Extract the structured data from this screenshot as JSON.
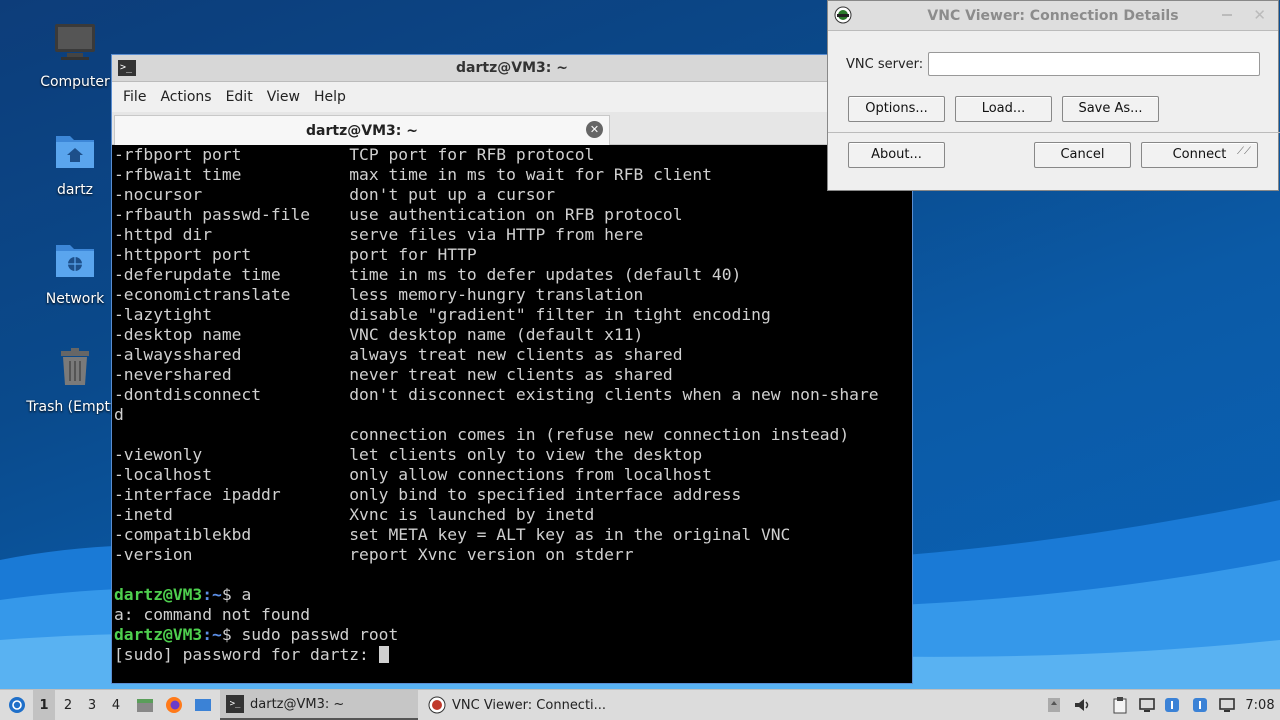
{
  "desktop": {
    "icons": [
      {
        "label": "Computer"
      },
      {
        "label": "dartz"
      },
      {
        "label": "Network"
      },
      {
        "label": "Trash (Empty)"
      }
    ]
  },
  "terminal": {
    "window_title": "dartz@VM3: ~",
    "menu": [
      "File",
      "Actions",
      "Edit",
      "View",
      "Help"
    ],
    "tab_label": "dartz@VM3: ~",
    "lines": [
      "-rfbport port           TCP port for RFB protocol",
      "-rfbwait time           max time in ms to wait for RFB client",
      "-nocursor               don't put up a cursor",
      "-rfbauth passwd-file    use authentication on RFB protocol",
      "-httpd dir              serve files via HTTP from here",
      "-httpport port          port for HTTP",
      "-deferupdate time       time in ms to defer updates (default 40)",
      "-economictranslate      less memory-hungry translation",
      "-lazytight              disable \"gradient\" filter in tight encoding",
      "-desktop name           VNC desktop name (default x11)",
      "-alwaysshared           always treat new clients as shared",
      "-nevershared            never treat new clients as shared",
      "-dontdisconnect         don't disconnect existing clients when a new non-share",
      "d",
      "                        connection comes in (refuse new connection instead)",
      "-viewonly               let clients only to view the desktop",
      "-localhost              only allow connections from localhost",
      "-interface ipaddr       only bind to specified interface address",
      "-inetd                  Xvnc is launched by inetd",
      "-compatiblekbd          set META key = ALT key as in the original VNC",
      "-version                report Xvnc version on stderr",
      ""
    ],
    "prompt_user": "dartz@VM3",
    "prompt_path": ":~",
    "prompt_sym": "$ ",
    "cmd1": "a",
    "out1": "a: command not found",
    "cmd2": "sudo passwd root",
    "sudo_prompt": "[sudo] password for dartz: "
  },
  "vnc": {
    "window_title": "VNC Viewer: Connection Details",
    "server_label": "VNC server:",
    "server_value": "",
    "buttons": {
      "options": "Options...",
      "load": "Load...",
      "save_as": "Save As...",
      "about": "About...",
      "cancel": "Cancel",
      "connect": "Connect"
    }
  },
  "taskbar": {
    "workspaces": [
      "1",
      "2",
      "3",
      "4"
    ],
    "tasks": [
      {
        "label": "dartz@VM3: ~"
      },
      {
        "label": "VNC Viewer: Connecti..."
      }
    ],
    "clock": "7:08"
  }
}
